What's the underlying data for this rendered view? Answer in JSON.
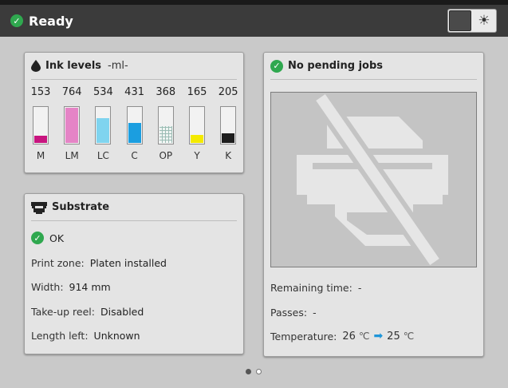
{
  "header": {
    "status_text": "Ready"
  },
  "theme_toggle": {
    "icon": "sun-icon"
  },
  "ink": {
    "title": "Ink levels",
    "units": "-ml-",
    "items": [
      {
        "value": "153",
        "label": "M",
        "color": "#c8157f",
        "level": 0.2
      },
      {
        "value": "764",
        "label": "LM",
        "color": "#e584c6",
        "level": 1.0
      },
      {
        "value": "534",
        "label": "LC",
        "color": "#7fd4ef",
        "level": 0.7
      },
      {
        "value": "431",
        "label": "C",
        "color": "#1b9ee0",
        "level": 0.56
      },
      {
        "value": "368",
        "label": "OP",
        "color": "#d8e8e4",
        "level": 0.48
      },
      {
        "value": "165",
        "label": "Y",
        "color": "#f4ea00",
        "level": 0.22
      },
      {
        "value": "205",
        "label": "K",
        "color": "#1e1e1e",
        "level": 0.27
      }
    ]
  },
  "substrate": {
    "title": "Substrate",
    "status": "OK",
    "print_zone_label": "Print zone:",
    "print_zone_value": "Platen installed",
    "width_label": "Width:",
    "width_value": "914 mm",
    "takeup_label": "Take-up reel:",
    "takeup_value": "Disabled",
    "length_label": "Length left:",
    "length_value": "Unknown"
  },
  "jobs": {
    "title": "No pending jobs",
    "remaining_label": "Remaining time:",
    "remaining_value": "-",
    "passes_label": "Passes:",
    "passes_value": "-",
    "temperature_label": "Temperature:",
    "temp_current": "26",
    "temp_target": "25",
    "temp_unit": "℃"
  },
  "pager": {
    "current_page": 1,
    "page_count": 2
  }
}
